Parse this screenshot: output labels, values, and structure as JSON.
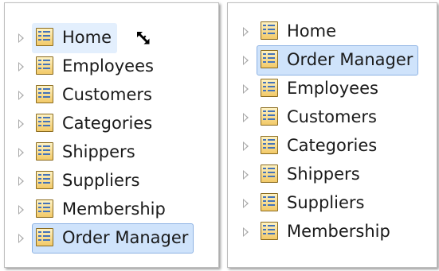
{
  "left_tree": {
    "items": [
      {
        "label": "Home",
        "state": "hover"
      },
      {
        "label": "Employees",
        "state": "normal"
      },
      {
        "label": "Customers",
        "state": "normal"
      },
      {
        "label": "Categories",
        "state": "normal"
      },
      {
        "label": "Shippers",
        "state": "normal"
      },
      {
        "label": "Suppliers",
        "state": "normal"
      },
      {
        "label": "Membership",
        "state": "normal"
      },
      {
        "label": "Order Manager",
        "state": "selected"
      }
    ]
  },
  "right_tree": {
    "items": [
      {
        "label": "Home",
        "state": "normal"
      },
      {
        "label": "Order Manager",
        "state": "selected"
      },
      {
        "label": "Employees",
        "state": "normal"
      },
      {
        "label": "Customers",
        "state": "normal"
      },
      {
        "label": "Categories",
        "state": "normal"
      },
      {
        "label": "Shippers",
        "state": "normal"
      },
      {
        "label": "Suppliers",
        "state": "normal"
      },
      {
        "label": "Membership",
        "state": "normal"
      }
    ]
  },
  "icons": {
    "node": "page-icon",
    "expander": "expand-arrow-icon",
    "cursor": "move-cursor-icon"
  },
  "colors": {
    "selection_fill": "#cfe3fb",
    "selection_border": "#8db2e3",
    "hover_fill": "#e3effd",
    "icon_blue": "#4473b9",
    "icon_gold": "#f2c968"
  }
}
